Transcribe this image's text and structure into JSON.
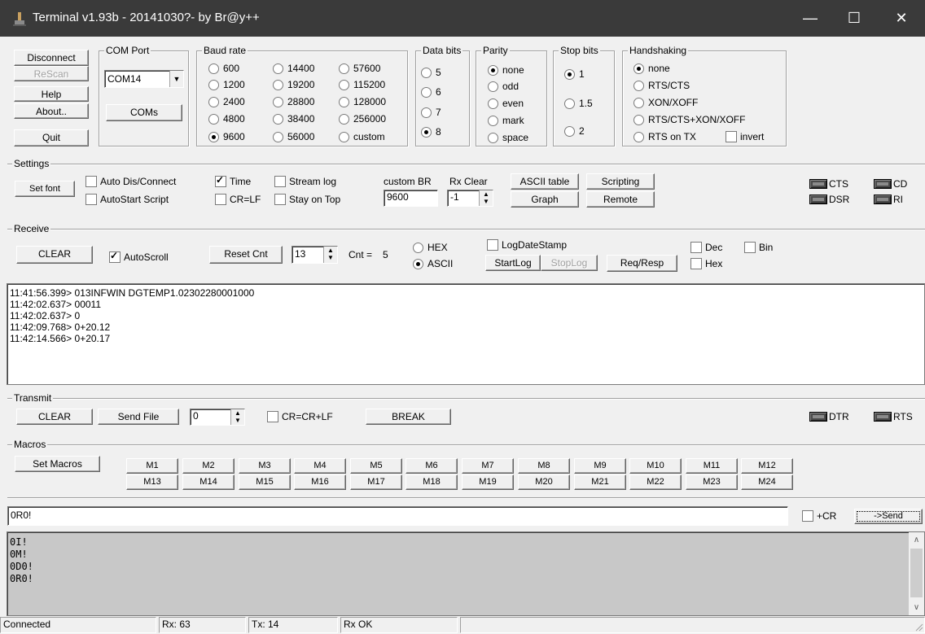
{
  "window": {
    "title": "Terminal v1.93b - 20141030?- by Br@y++",
    "minimize": "—",
    "maximize": "☐",
    "close": "✕"
  },
  "conn": {
    "disconnect": "Disconnect",
    "rescan": "ReScan",
    "help": "Help",
    "about": "About..",
    "quit": "Quit"
  },
  "com": {
    "title": "COM Port",
    "selected": "COM14",
    "coms_button": "COMs"
  },
  "baud": {
    "title": "Baud rate",
    "options": [
      "600",
      "1200",
      "2400",
      "4800",
      "9600",
      "14400",
      "19200",
      "28800",
      "38400",
      "56000",
      "57600",
      "115200",
      "128000",
      "256000",
      "custom"
    ],
    "selected": "9600"
  },
  "databits": {
    "title": "Data bits",
    "options": [
      "5",
      "6",
      "7",
      "8"
    ],
    "selected": "8"
  },
  "parity": {
    "title": "Parity",
    "options": [
      "none",
      "odd",
      "even",
      "mark",
      "space"
    ],
    "selected": "none"
  },
  "stopbits": {
    "title": "Stop bits",
    "options": [
      "1",
      "1.5",
      "2"
    ],
    "selected": "1"
  },
  "handshaking": {
    "title": "Handshaking",
    "options": [
      "none",
      "RTS/CTS",
      "XON/XOFF",
      "RTS/CTS+XON/XOFF",
      "RTS on TX"
    ],
    "selected": "none",
    "invert_label": "invert"
  },
  "settings": {
    "title": "Settings",
    "set_font": "Set font",
    "auto_dis_connect": "Auto Dis/Connect",
    "autostart_script": "AutoStart Script",
    "time": "Time",
    "cr_lf": "CR=LF",
    "stream_log": "Stream log",
    "stay_on_top": "Stay on Top",
    "custom_br_label": "custom BR",
    "custom_br_value": "9600",
    "rx_clear_label": "Rx Clear",
    "rx_clear_value": "-1",
    "ascii_table": "ASCII table",
    "scripting": "Scripting",
    "graph": "Graph",
    "remote": "Remote",
    "leds": {
      "cts": "CTS",
      "cd": "CD",
      "dsr": "DSR",
      "ri": "RI"
    }
  },
  "receive": {
    "title": "Receive",
    "clear": "CLEAR",
    "autoscroll": "AutoScroll",
    "reset_cnt": "Reset Cnt",
    "cnt_spin": "13",
    "cnt_label": "Cnt =",
    "cnt_value": "5",
    "hex": "HEX",
    "ascii": "ASCII",
    "logdatestamp": "LogDateStamp",
    "startlog": "StartLog",
    "stoplog": "StopLog",
    "req_resp": "Req/Resp",
    "dec": "Dec",
    "bin": "Bin",
    "hex_chk": "Hex",
    "lines": [
      "11:41:56.399> 013INFWIN  DGTEMP1.02302280001000",
      "11:42:02.637> 00011",
      "11:42:02.637> 0",
      "11:42:09.768> 0+20.12",
      "11:42:14.566> 0+20.17"
    ]
  },
  "transmit": {
    "title": "Transmit",
    "clear": "CLEAR",
    "send_file": "Send File",
    "spin_value": "0",
    "cr_crlf": "CR=CR+LF",
    "break": "BREAK",
    "leds": {
      "dtr": "DTR",
      "rts": "RTS"
    }
  },
  "macros": {
    "title": "Macros",
    "set_macros": "Set Macros",
    "row1": [
      "M1",
      "M2",
      "M3",
      "M4",
      "M5",
      "M6",
      "M7",
      "M8",
      "M9",
      "M10",
      "M11",
      "M12"
    ],
    "row2": [
      "M13",
      "M14",
      "M15",
      "M16",
      "M17",
      "M18",
      "M19",
      "M20",
      "M21",
      "M22",
      "M23",
      "M24"
    ]
  },
  "send": {
    "input_value": "0R0!",
    "plus_cr": "+CR",
    "send_button": "->Send"
  },
  "history": [
    "0I!",
    "0M!",
    "0D0!",
    "0R0!"
  ],
  "status": {
    "connected": "Connected",
    "rx": "Rx: 63",
    "tx": "Tx: 14",
    "rx_ok": "Rx OK"
  }
}
